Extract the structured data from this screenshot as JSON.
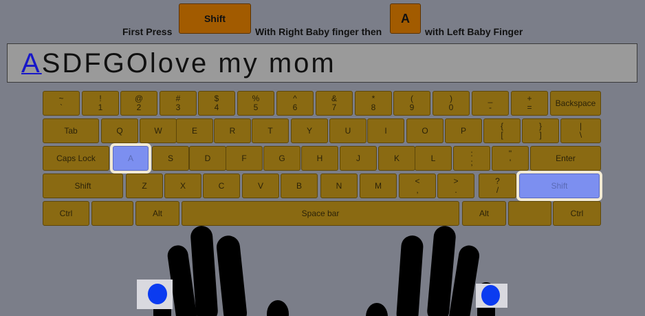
{
  "instructions": {
    "first_press": "First Press",
    "key1": "Shift",
    "middle_text": "With Right Baby finger then",
    "key2": "A",
    "end_text": "with Left Baby Finger"
  },
  "display": {
    "current_char": "A",
    "remaining": "SDFGOlove my mom"
  },
  "keyboard": {
    "row1": [
      {
        "top": "~",
        "bottom": "`"
      },
      {
        "top": "!",
        "bottom": "1"
      },
      {
        "top": "@",
        "bottom": "2"
      },
      {
        "top": "#",
        "bottom": "3"
      },
      {
        "top": "$",
        "bottom": "4"
      },
      {
        "top": "%",
        "bottom": "5"
      },
      {
        "top": "^",
        "bottom": "6"
      },
      {
        "top": "&",
        "bottom": "7"
      },
      {
        "top": "*",
        "bottom": "8"
      },
      {
        "top": "(",
        "bottom": "9"
      },
      {
        "top": ")",
        "bottom": "0"
      },
      {
        "top": "_",
        "bottom": "-"
      },
      {
        "top": "+",
        "bottom": "="
      },
      {
        "label": "Backspace"
      }
    ],
    "row2": [
      {
        "label": "Tab"
      },
      {
        "label": "Q"
      },
      {
        "label": "W"
      },
      {
        "label": "E"
      },
      {
        "label": "R"
      },
      {
        "label": "T"
      },
      {
        "label": "Y"
      },
      {
        "label": "U"
      },
      {
        "label": "I"
      },
      {
        "label": "O"
      },
      {
        "label": "P"
      },
      {
        "top": "{",
        "bottom": "["
      },
      {
        "top": "}",
        "bottom": "]"
      },
      {
        "top": "|",
        "bottom": "\\"
      }
    ],
    "row3": [
      {
        "label": "Caps Lock"
      },
      {
        "label": "A",
        "highlight": true
      },
      {
        "label": "S"
      },
      {
        "label": "D"
      },
      {
        "label": "F"
      },
      {
        "label": "G"
      },
      {
        "label": "H"
      },
      {
        "label": "J"
      },
      {
        "label": "K"
      },
      {
        "label": "L"
      },
      {
        "top": ":",
        "bottom": ";"
      },
      {
        "top": "\"",
        "bottom": "'"
      },
      {
        "label": "Enter"
      }
    ],
    "row4": [
      {
        "label": "Shift"
      },
      {
        "label": "Z"
      },
      {
        "label": "X"
      },
      {
        "label": "C"
      },
      {
        "label": "V"
      },
      {
        "label": "B"
      },
      {
        "label": "N"
      },
      {
        "label": "M"
      },
      {
        "top": "<",
        "bottom": ","
      },
      {
        "top": ">",
        "bottom": "."
      },
      {
        "top": "?",
        "bottom": "/"
      },
      {
        "label": "Shift",
        "highlight": true
      }
    ],
    "row5": [
      {
        "label": "Ctrl"
      },
      {
        "label": ""
      },
      {
        "label": "Alt"
      },
      {
        "label": "Space bar"
      },
      {
        "label": "Alt"
      },
      {
        "label": ""
      },
      {
        "label": "Ctrl"
      }
    ]
  },
  "colors": {
    "key": "#8a6a12",
    "key_highlight": "#7c8ff0",
    "instruction_key": "#a25b00",
    "background": "#7b7e89",
    "finger_marker": "#0b3bf0",
    "hand": "#000000"
  }
}
